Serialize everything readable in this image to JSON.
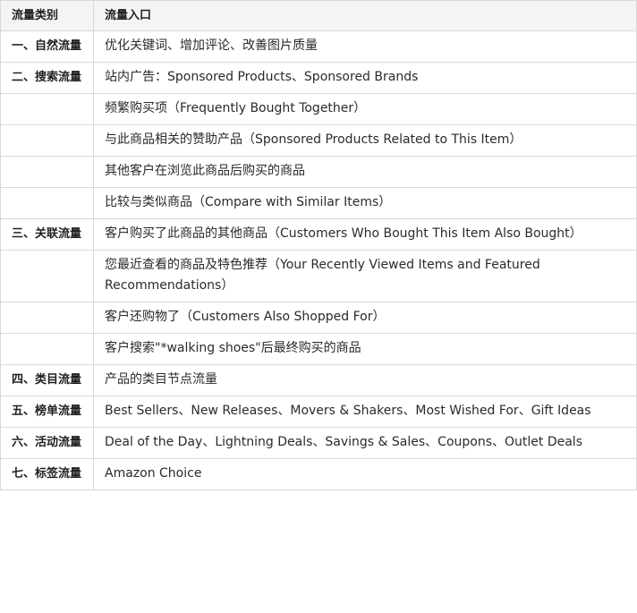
{
  "table": {
    "headers": [
      "流量类别",
      "流量入口"
    ],
    "rows": [
      {
        "category": "一、自然流量",
        "source": "优化关键词、增加评论、改善图片质量"
      },
      {
        "category": "二、搜索流量",
        "source": "站内广告：Sponsored Products、Sponsored Brands"
      },
      {
        "category": "",
        "source": "频繁购买项（Frequently Bought Together）"
      },
      {
        "category": "",
        "source": "与此商品相关的赞助产品（Sponsored Products Related to This Item）"
      },
      {
        "category": "",
        "source": "其他客户在浏览此商品后购买的商品"
      },
      {
        "category": "",
        "source": "比较与类似商品（Compare with Similar Items）"
      },
      {
        "category": "三、关联流量",
        "source": "客户购买了此商品的其他商品（Customers Who Bought This Item Also Bought）"
      },
      {
        "category": "",
        "source": "您最近查看的商品及特色推荐（Your Recently Viewed Items and Featured Recommendations）"
      },
      {
        "category": "",
        "source": "客户还购物了（Customers Also Shopped For）"
      },
      {
        "category": "",
        "source": "客户搜索\"*walking shoes\"后最终购买的商品"
      },
      {
        "category": "四、类目流量",
        "source": "产品的类目节点流量"
      },
      {
        "category": "五、榜单流量",
        "source": "Best Sellers、New Releases、Movers & Shakers、Most Wished For、Gift Ideas"
      },
      {
        "category": "六、活动流量",
        "source": "Deal of the Day、Lightning Deals、Savings & Sales、Coupons、Outlet Deals"
      },
      {
        "category": "七、标签流量",
        "source": "Amazon Choice"
      }
    ]
  }
}
